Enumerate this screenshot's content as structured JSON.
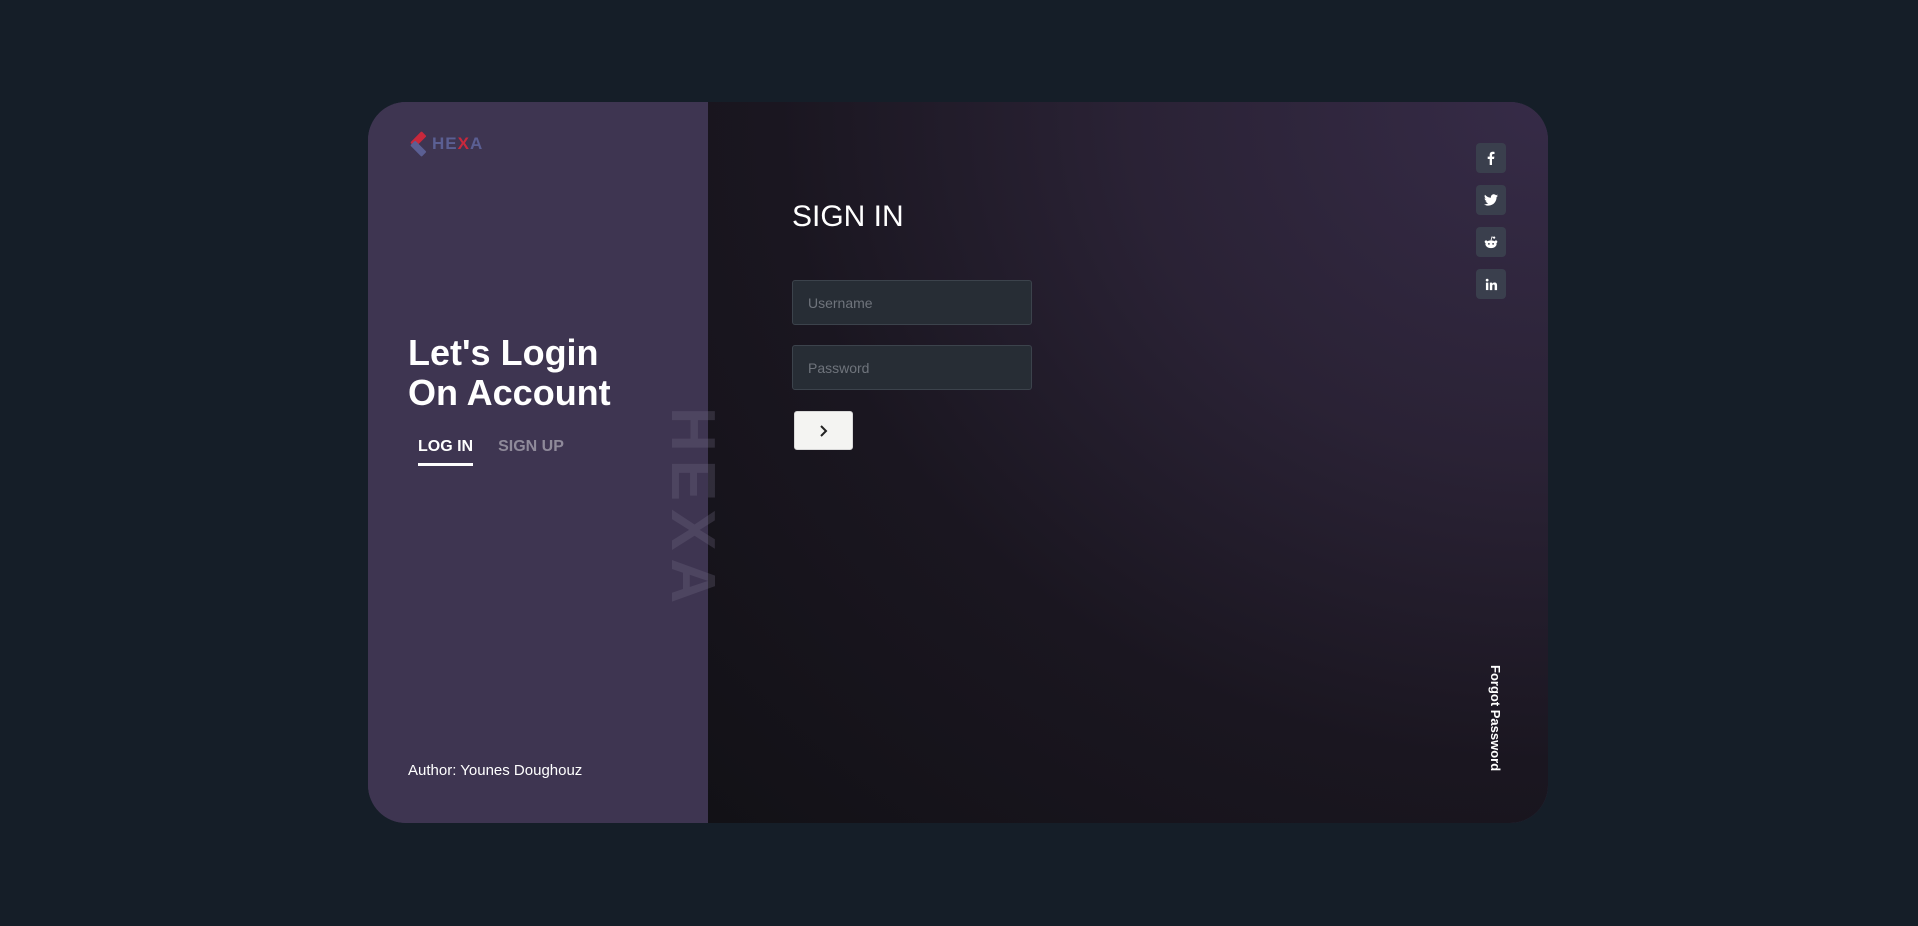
{
  "brand": {
    "logo_text_main": "HE",
    "logo_text_accent": "X",
    "logo_text_end": "A",
    "watermark": "HEXA",
    "accent_color": "#c8283c"
  },
  "left": {
    "headline_line1": "Let's Login",
    "headline_line2": "On Account",
    "tabs": [
      {
        "label": "LOG IN",
        "active": true
      },
      {
        "label": "SIGN UP",
        "active": false
      }
    ],
    "author": "Author: Younes Doughouz"
  },
  "form": {
    "title": "SIGN IN",
    "username_placeholder": "Username",
    "password_placeholder": "Password",
    "submit_icon": "chevron-right-icon"
  },
  "socials": [
    {
      "name": "facebook-icon",
      "glyph": "f"
    },
    {
      "name": "twitter-icon",
      "glyph": "t"
    },
    {
      "name": "reddit-icon",
      "glyph": "r"
    },
    {
      "name": "linkedin-icon",
      "glyph": "in"
    }
  ],
  "forgot_password": "Forgot Password"
}
